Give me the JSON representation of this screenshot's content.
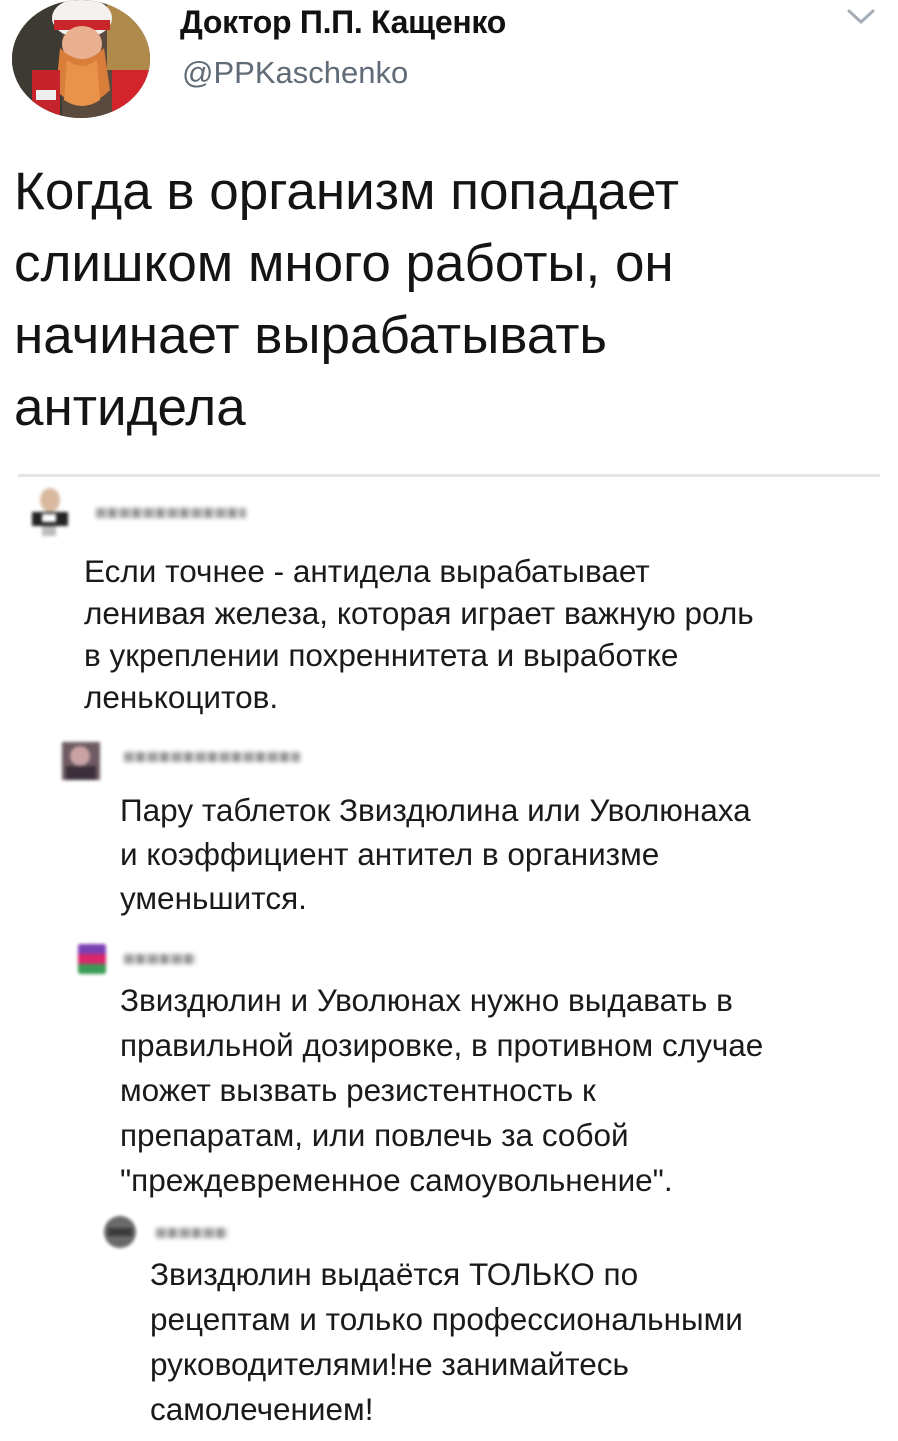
{
  "tweet": {
    "author_name": "Доктор П.П. Кащенко",
    "author_handle": "@PPKaschenko",
    "text_lines": [
      "Когда в организм попадает",
      "слишком много работы, он",
      "начинает вырабатывать",
      "антидела"
    ]
  },
  "icons": {
    "menu": "chevron-down-icon"
  },
  "comments": [
    {
      "text_lines": [
        "Если точнее - антидела вырабатывает",
        "ленивая железа, которая играет важную роль",
        "в укреплении похреннитета и выработке",
        "ленькоцитов."
      ]
    },
    {
      "text_lines": [
        "Пару таблеток Звиздюлина или Уволюнаха",
        "и коэффициент антител в организме",
        "уменьшится."
      ]
    },
    {
      "text_lines": [
        "Звиздюлин и Уволюнах нужно выдавать в",
        "правильной дозировке, в противном случае",
        "может вызвать резистентность к",
        "препаратам, или повлечь за собой",
        "\"преждевременное самоувольнение\"."
      ]
    },
    {
      "text_lines": [
        "Звиздюлин выдаётся ТОЛЬКО по",
        "рецептам и только профессиональными",
        "руководителями!не занимайтесь",
        "самолечением!"
      ]
    }
  ],
  "colors": {
    "text": "#141414",
    "handle": "#5f6b77",
    "divider": "#e3e6e9"
  }
}
